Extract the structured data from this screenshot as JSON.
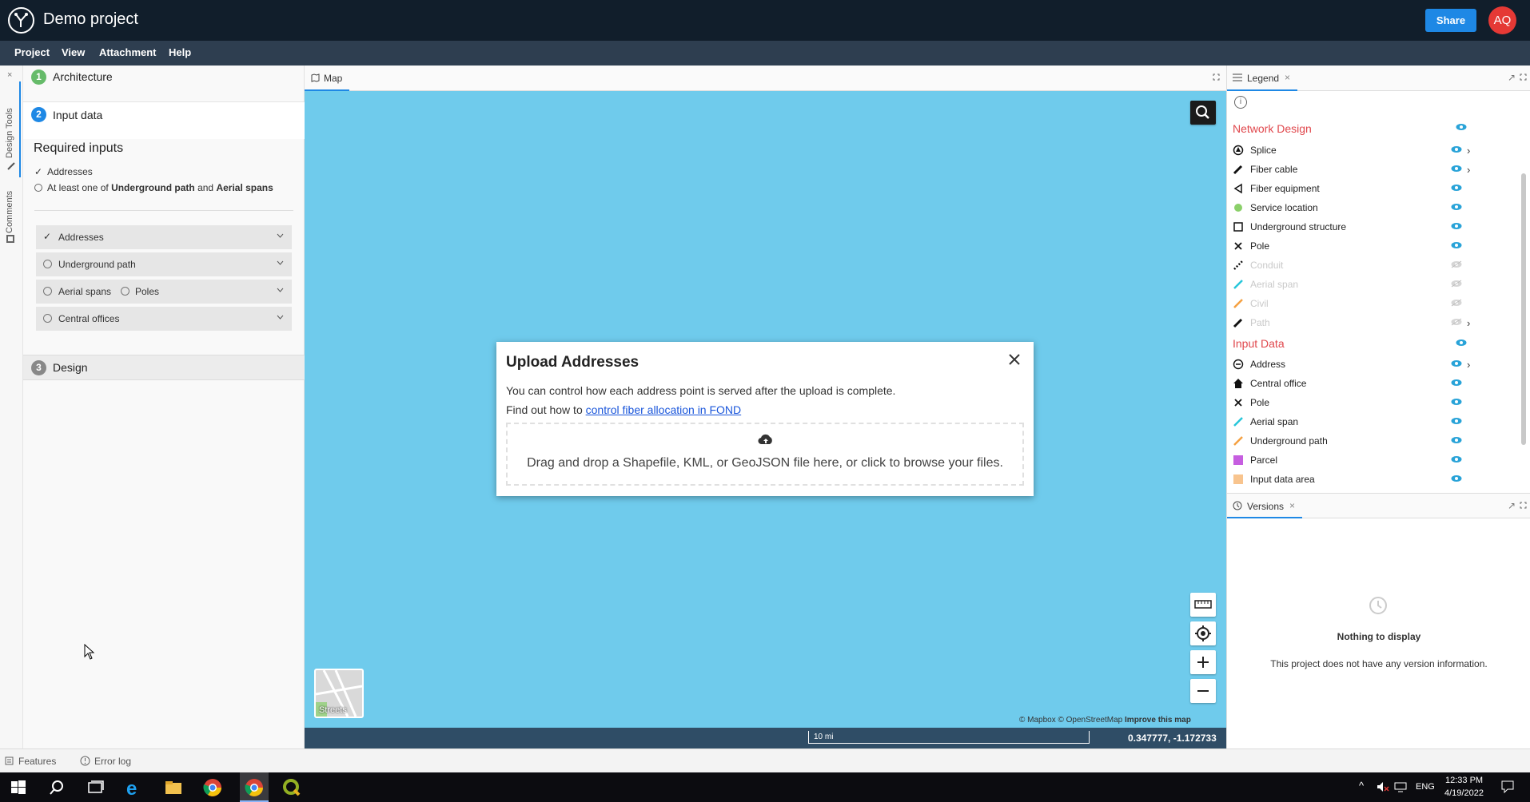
{
  "app": {
    "title": "Demo project",
    "share_label": "Share",
    "avatar_initials": "AQ"
  },
  "menu": [
    "Project",
    "View",
    "Attachment",
    "Help"
  ],
  "left_strip": {
    "design_tools": "Design Tools",
    "comments": "Comments"
  },
  "steps": [
    {
      "num": "1",
      "label": "Architecture",
      "color": "#66bb6a"
    },
    {
      "num": "2",
      "label": "Input data",
      "color": "#1e88e5"
    },
    {
      "num": "3",
      "label": "Design",
      "color": "#888888"
    }
  ],
  "required": {
    "title": "Required inputs",
    "addresses": "Addresses",
    "at_least_prefix": "At least one of",
    "underground": "Underground path",
    "and": "and",
    "aerial": "Aerial spans"
  },
  "accordions": {
    "addresses": "Addresses",
    "underground": "Underground path",
    "aerial_spans": "Aerial spans",
    "poles": "Poles",
    "central_offices": "Central offices"
  },
  "map": {
    "tab_label": "Map",
    "basemap_label": "Streets",
    "attribution": "© Mapbox © OpenStreetMap",
    "improve": "Improve this map",
    "scale": "10 mi",
    "coords": "0.347777, -1.172733",
    "bg_color": "#6fcbec"
  },
  "modal": {
    "title": "Upload Addresses",
    "line1": "You can control how each address point is served after the upload is complete.",
    "line2_prefix": "Find out how to",
    "link": "control fiber allocation in FOND",
    "drop_text": "Drag and drop a Shapefile, KML, or GeoJSON file here, or click to browse your files."
  },
  "legend": {
    "tab_label": "Legend",
    "network_design": "Network Design",
    "input_data": "Input Data",
    "network_items": [
      {
        "label": "Splice",
        "icon": "splice-icon"
      },
      {
        "label": "Fiber cable",
        "icon": "pencil-icon"
      },
      {
        "label": "Fiber equipment",
        "icon": "triangle-icon"
      },
      {
        "label": "Service location",
        "icon": "green-dot-icon"
      },
      {
        "label": "Underground structure",
        "icon": "square-icon"
      },
      {
        "label": "Pole",
        "icon": "x-icon"
      },
      {
        "label": "Conduit",
        "icon": "dashed-line-icon"
      },
      {
        "label": "Aerial span",
        "icon": "teal-line-icon"
      },
      {
        "label": "Civil",
        "icon": "orange-line-icon"
      },
      {
        "label": "Path",
        "icon": "pencil-icon"
      }
    ],
    "input_items": [
      {
        "label": "Address",
        "icon": "address-icon"
      },
      {
        "label": "Central office",
        "icon": "home-icon"
      },
      {
        "label": "Pole",
        "icon": "x-icon"
      },
      {
        "label": "Aerial span",
        "icon": "teal-line-icon"
      },
      {
        "label": "Underground path",
        "icon": "orange-line-icon"
      },
      {
        "label": "Parcel",
        "icon": "purple-square-icon"
      },
      {
        "label": "Input data area",
        "icon": "peach-square-icon"
      }
    ]
  },
  "versions": {
    "tab_label": "Versions",
    "empty_title": "Nothing to display",
    "empty_text": "This project does not have any version information."
  },
  "bottom": {
    "features": "Features",
    "error_log": "Error log"
  },
  "taskbar": {
    "time": "12:33 PM",
    "date": "4/19/2022",
    "lang": "ENG"
  }
}
